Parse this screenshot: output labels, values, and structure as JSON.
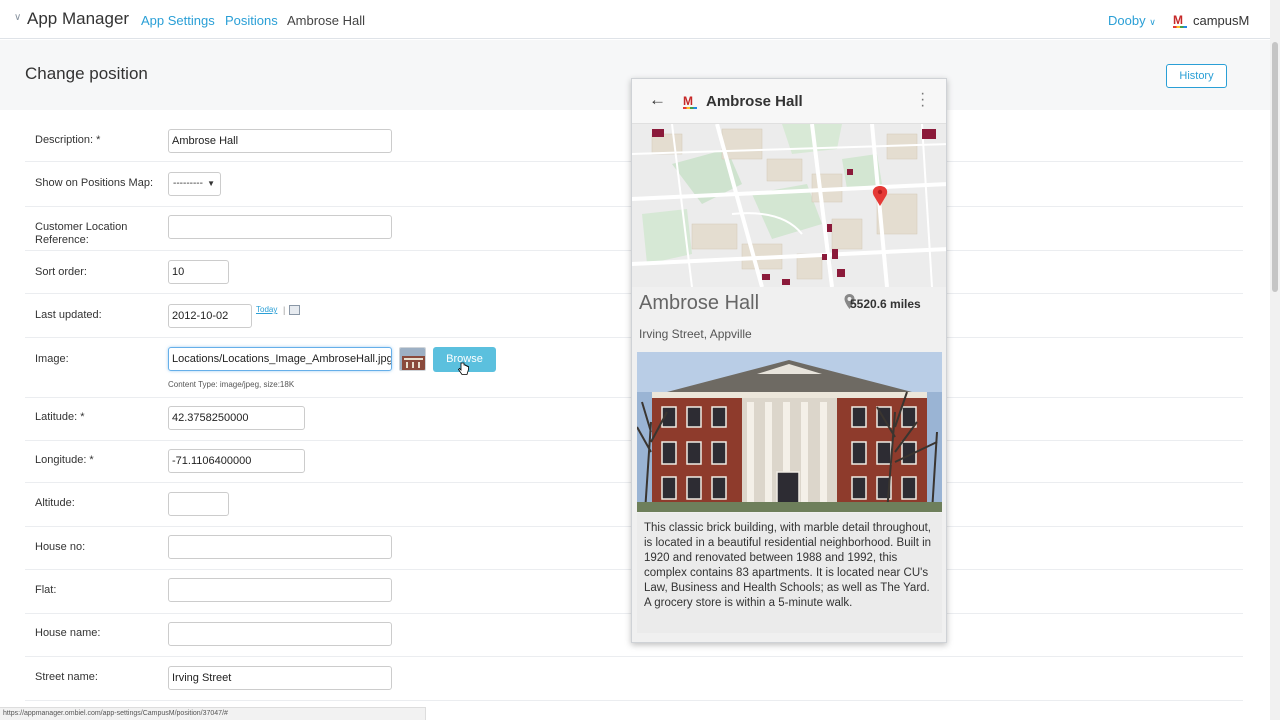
{
  "topbar": {
    "app_title": "App Manager",
    "breadcrumbs": [
      "App Settings",
      "Positions",
      "Ambrose Hall"
    ],
    "user": "Dooby",
    "brand": "campusM"
  },
  "page": {
    "title": "Change position",
    "history_label": "History"
  },
  "form": {
    "description": {
      "label": "Description: *",
      "value": "Ambrose Hall"
    },
    "show_on_map": {
      "label": "Show on Positions Map:",
      "value": "---------"
    },
    "customer_ref": {
      "label": "Customer Location Reference:",
      "value": ""
    },
    "sort_order": {
      "label": "Sort order:",
      "value": "10"
    },
    "last_updated": {
      "label": "Last updated:",
      "value": "2012-10-02",
      "today": "Today",
      "sep": "|"
    },
    "image": {
      "label": "Image:",
      "value": "Locations/Locations_Image_AmbroseHall.jpg",
      "browse": "Browse",
      "help": "Content Type: image/jpeg, size:18K"
    },
    "latitude": {
      "label": "Latitude: *",
      "value": "42.3758250000"
    },
    "longitude": {
      "label": "Longitude: *",
      "value": "-71.1106400000"
    },
    "altitude": {
      "label": "Altitude:",
      "value": ""
    },
    "house_no": {
      "label": "House no:",
      "value": ""
    },
    "flat": {
      "label": "Flat:",
      "value": ""
    },
    "house_name": {
      "label": "House name:",
      "value": ""
    },
    "street_name": {
      "label": "Street name:",
      "value": "Irving Street"
    }
  },
  "preview": {
    "title": "Ambrose Hall",
    "place_name": "Ambrose Hall",
    "distance": "5520.6 miles",
    "address": "Irving Street, Appville",
    "description": "This classic brick building, with marble detail throughout, is located in a beautiful residential neighborhood. Built in 1920 and renovated between 1988 and 1992, this complex contains 83 apartments. It is located near CU's Law, Business and Health Schools; as well as The Yard. A grocery store is within a 5-minute walk."
  },
  "status_url": "https://appmanager.ombiel.com/app-settings/CampusM/position/37047/#",
  "colors": {
    "accent": "#2a9fd6",
    "browse": "#5bc0de",
    "map_building": "#8b1a3a",
    "pin": "#e53935"
  }
}
